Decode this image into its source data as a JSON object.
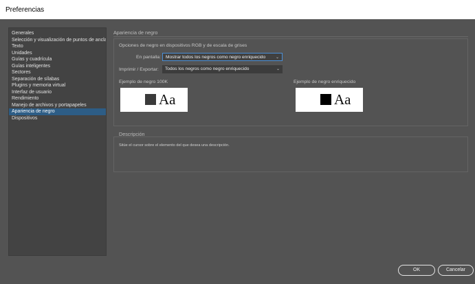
{
  "window": {
    "title": "Preferencias"
  },
  "sidebar": {
    "items": [
      {
        "label": "Generales"
      },
      {
        "label": "Selección y visualización de puntos de ancla"
      },
      {
        "label": "Texto"
      },
      {
        "label": "Unidades"
      },
      {
        "label": "Guías y cuadrícula"
      },
      {
        "label": "Guías inteligentes"
      },
      {
        "label": "Sectores"
      },
      {
        "label": "Separación de sílabas"
      },
      {
        "label": "Plugins y memoria virtual"
      },
      {
        "label": "Interfaz de usuario"
      },
      {
        "label": "Rendimiento"
      },
      {
        "label": "Manejo de archivos y portapapeles"
      },
      {
        "label": "Apariencia de negro"
      },
      {
        "label": "Dispositivos"
      }
    ],
    "selected_index": 12
  },
  "main": {
    "section_title": "Apariencia de negro",
    "options_title": "Opciones de negro en dispositivos RGB y de escala de grises",
    "on_screen": {
      "label": "En pantalla:",
      "value": "Mostrar todos los negros como negro enriquecido"
    },
    "print_export": {
      "label": "Imprimir / Exportar:",
      "value": "Todos los negros como negro enriquecido"
    },
    "sample_100k": {
      "label": "Ejemplo de negro 100K",
      "text": "Aa",
      "swatch_color": "#3a3a3a"
    },
    "sample_rich": {
      "label": "Ejemplo de negro enriquecido",
      "text": "Aa",
      "swatch_color": "#000000"
    },
    "description": {
      "title": "Descripción",
      "text": "Sitúe el cursor sobre el elemento del que desea una descripción."
    }
  },
  "buttons": {
    "ok": "OK",
    "cancel": "Cancelar"
  },
  "colors": {
    "selection": "#2d5d86",
    "background": "#535353",
    "focus": "#4a90d9"
  }
}
